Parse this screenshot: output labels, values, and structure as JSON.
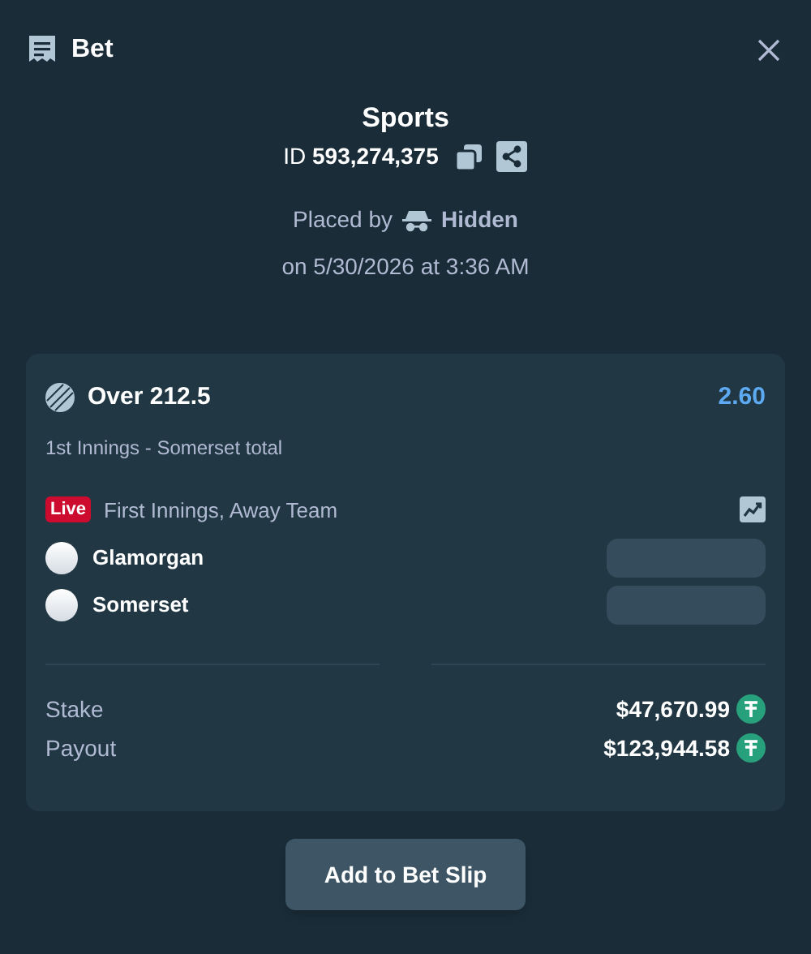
{
  "header": {
    "title": "Bet"
  },
  "summary": {
    "category": "Sports",
    "id_text": "ID **593,274,375**",
    "placed_by_label": "Placed by",
    "placed_by_user": "Hidden",
    "date": "on 5/30/2026 at 3:36 AM"
  },
  "selection": {
    "name": "Over 212.5",
    "odds": "2.60",
    "market": "1st Innings - Somerset total",
    "live": true,
    "live_label": "Live",
    "event": "First Innings, Away Team",
    "teams": [
      {
        "name": "Glamorgan"
      },
      {
        "name": "Somerset"
      }
    ]
  },
  "totals": [
    {
      "label": "Stake",
      "amount": "$47,670.99"
    },
    {
      "label": "Payout",
      "amount": "$123,944.58"
    }
  ],
  "action": {
    "label": "Add to Bet Slip"
  }
}
